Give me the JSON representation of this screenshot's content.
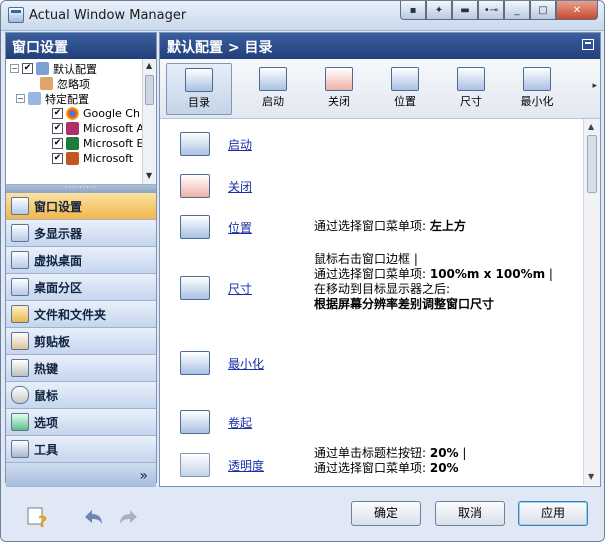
{
  "window": {
    "title": "Actual Window Manager",
    "titlebar_buttons": [
      "pin-icon",
      "settings-icon",
      "minimize-to-tray-icon",
      "key-icon",
      "minimize-icon",
      "maximize-icon",
      "close-icon"
    ]
  },
  "left_panel": {
    "header": "窗口设置",
    "tree": [
      {
        "label": "默认配置",
        "checked": true,
        "level": 1
      },
      {
        "label": "忽略项",
        "level": 1
      },
      {
        "label": "特定配置",
        "level": 1
      },
      {
        "label": "Google Ch",
        "checked": true,
        "level": 2
      },
      {
        "label": "Microsoft A",
        "checked": true,
        "level": 2
      },
      {
        "label": "Microsoft E",
        "checked": true,
        "level": 2
      },
      {
        "label": "Microsoft ",
        "checked": true,
        "level": 2
      }
    ],
    "nav": [
      {
        "label": "窗口设置",
        "active": true
      },
      {
        "label": "多显示器"
      },
      {
        "label": "虚拟桌面"
      },
      {
        "label": "桌面分区"
      },
      {
        "label": "文件和文件夹"
      },
      {
        "label": "剪贴板"
      },
      {
        "label": "热键"
      },
      {
        "label": "鼠标"
      },
      {
        "label": "选项"
      },
      {
        "label": "工具"
      }
    ],
    "footer_chevron": "»"
  },
  "right_panel": {
    "header": "默认配置 > 目录",
    "toolbar": [
      {
        "label": "目录",
        "active": true
      },
      {
        "label": "启动"
      },
      {
        "label": "关闭"
      },
      {
        "label": "位置"
      },
      {
        "label": "尺寸"
      },
      {
        "label": "最小化"
      }
    ],
    "items": [
      {
        "label": "启动",
        "icon": "startup-window-icon"
      },
      {
        "label": "关闭",
        "icon": "close-window-icon"
      },
      {
        "label": "位置",
        "icon": "position-window-icon",
        "desc": [
          "通过选择窗口菜单项: ",
          "左上方"
        ]
      },
      {
        "label": "尺寸",
        "icon": "size-window-icon"
      },
      {
        "label": "最小化",
        "icon": "minimize-window-icon"
      },
      {
        "label": "卷起",
        "icon": "rollup-window-icon"
      },
      {
        "label": "透明度",
        "icon": "transparency-window-icon"
      }
    ],
    "size_desc": {
      "line1": "鼠标右击窗口边框 |",
      "line2a": " 通过选择窗口菜单项: ",
      "line2b": "100%m x 100%m",
      "line2c": " |",
      "line3": " 在移动到目标显示器之后:",
      "line4": "根据屏幕分辨率差别调整窗口尺寸"
    },
    "transparency_desc": {
      "line1a": "通过单击标题栏按钮: ",
      "line1b": "20%",
      "line1c": " |",
      "line2a": " 通过选择窗口菜单项: ",
      "line2b": "20%"
    }
  },
  "buttons": {
    "ok": "确定",
    "cancel": "取消",
    "apply": "应用"
  }
}
